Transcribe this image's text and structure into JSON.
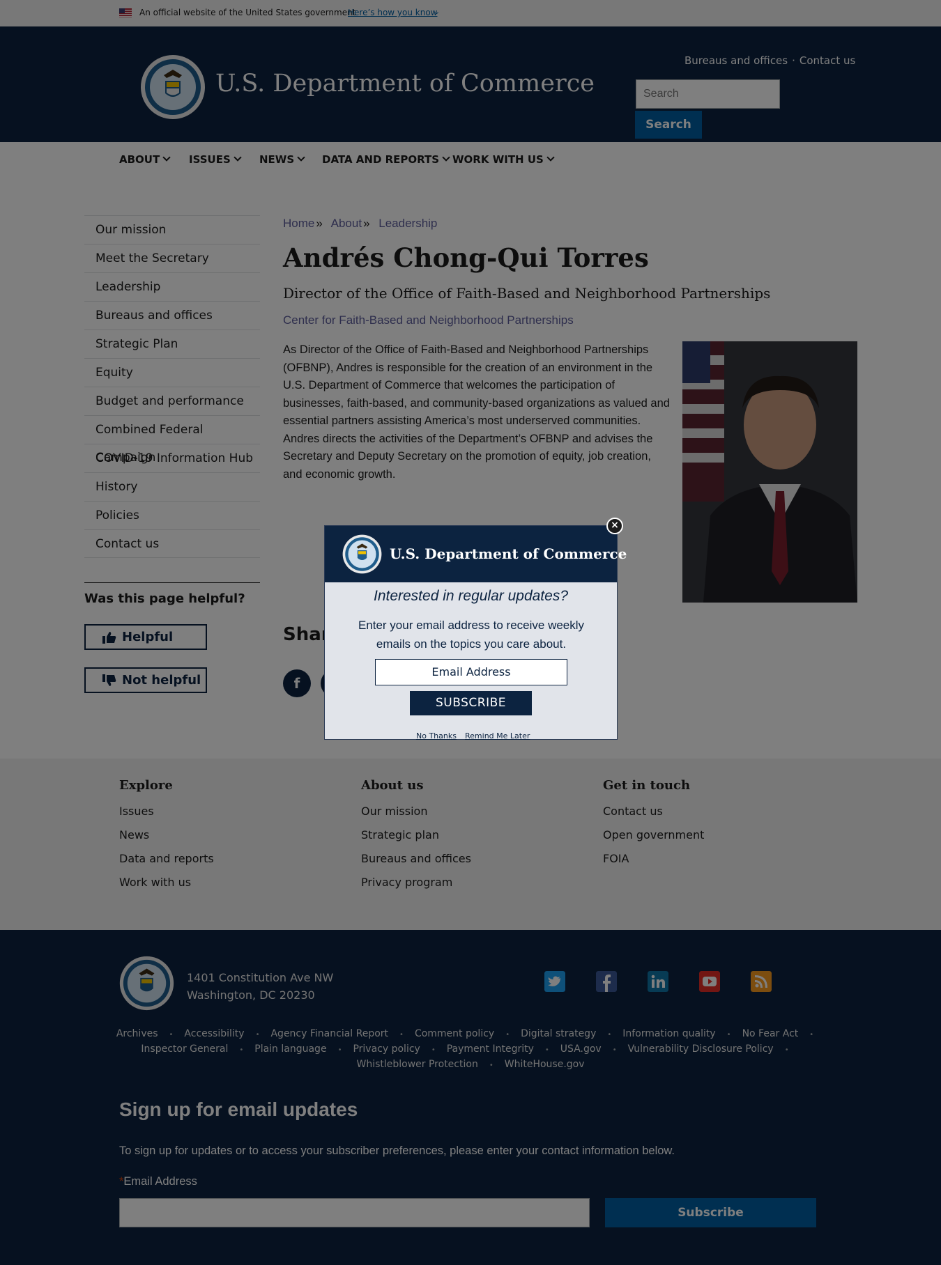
{
  "gov_banner": {
    "text": "An official website of the United States government",
    "how_link": "Here’s how you know"
  },
  "header": {
    "title": "U.S. Department of Commerce",
    "util_links": [
      "Bureaus and offices",
      "Contact us"
    ],
    "util_sep": "·",
    "search_placeholder": "Search",
    "search_button": "Search"
  },
  "nav": {
    "items": [
      "ABOUT",
      "ISSUES",
      "NEWS",
      "DATA AND REPORTS",
      "WORK WITH US"
    ]
  },
  "sidebar": {
    "items": [
      "Our mission",
      "Meet the Secretary",
      "Leadership",
      "Bureaus and offices",
      "Strategic Plan",
      "Equity",
      "Budget and performance",
      "Combined Federal Campaign",
      "COVID-19 Information Hub",
      "History",
      "Policies",
      "Contact us"
    ]
  },
  "helpful": {
    "question": "Was this page helpful?",
    "yes": "Helpful",
    "no": "Not helpful"
  },
  "breadcrumb": {
    "items": [
      "Home",
      "About",
      "Leadership"
    ],
    "sep": "»"
  },
  "main": {
    "title": "Andrés Chong-Qui Torres",
    "subtitle": "Director of the Office of Faith-Based and Neighborhood Partnerships",
    "center_link": "Center for Faith-Based and Neighborhood Partnerships",
    "bio": "As Director of the Office of Faith-Based and Neighborhood Partnerships (OFBNP), Andres is responsible for the creation of an environment in the U.S. Department of Commerce that welcomes the participation of businesses, faith-based, and community-based organizations as valued and essential partners assisting America’s most underserved communities. Andres directs the activities of the Department’s OFBNP and advises the Secretary and Deputy Secretary on the promotion of equity, job creation, and economic growth.",
    "share_title": "Share"
  },
  "modal": {
    "title": "U.S. Department of Commerce",
    "question": "Interested in regular updates?",
    "desc": "Enter your email address to receive weekly emails on the topics you care about.",
    "email_placeholder": "Email Address",
    "subscribe": "SUBSCRIBE",
    "no_thanks": "No Thanks",
    "remind_later": "Remind Me Later"
  },
  "footer": {
    "explore": {
      "title": "Explore",
      "links": [
        "Issues",
        "News",
        "Data and reports",
        "Work with us"
      ]
    },
    "about": {
      "title": "About us",
      "links": [
        "Our mission",
        "Strategic plan",
        "Bureaus and offices",
        "Privacy program"
      ]
    },
    "contact": {
      "title": "Get in touch",
      "links": [
        "Contact us",
        "Open government",
        "FOIA"
      ]
    },
    "address_line1": "1401 Constitution Ave NW",
    "address_line2": "Washington, DC 20230",
    "social": [
      "twitter-icon",
      "facebook-icon",
      "linkedin-icon",
      "youtube-icon",
      "rss-icon"
    ],
    "bottom_links_row1": [
      "Archives",
      "Accessibility",
      "Agency Financial Report",
      "Comment policy",
      "Digital strategy",
      "Information quality",
      "No Fear Act"
    ],
    "bottom_links_row2": [
      "Inspector General",
      "Plain language",
      "Privacy policy",
      "Payment Integrity",
      "USA.gov",
      "Vulnerability Disclosure Policy"
    ],
    "bottom_links_row3": [
      "Whistleblower Protection",
      "WhiteHouse.gov"
    ],
    "link_sep": "•"
  },
  "signup": {
    "title": "Sign up for email updates",
    "desc": "To sign up for updates or to access your subscriber preferences, please enter your contact information below.",
    "required_mark": "*",
    "label": "Email Address",
    "button": "Subscribe"
  },
  "colors": {
    "navy": "#0c2340",
    "primary_blue": "#005ea2",
    "link_purple": "#5d5d9b"
  }
}
